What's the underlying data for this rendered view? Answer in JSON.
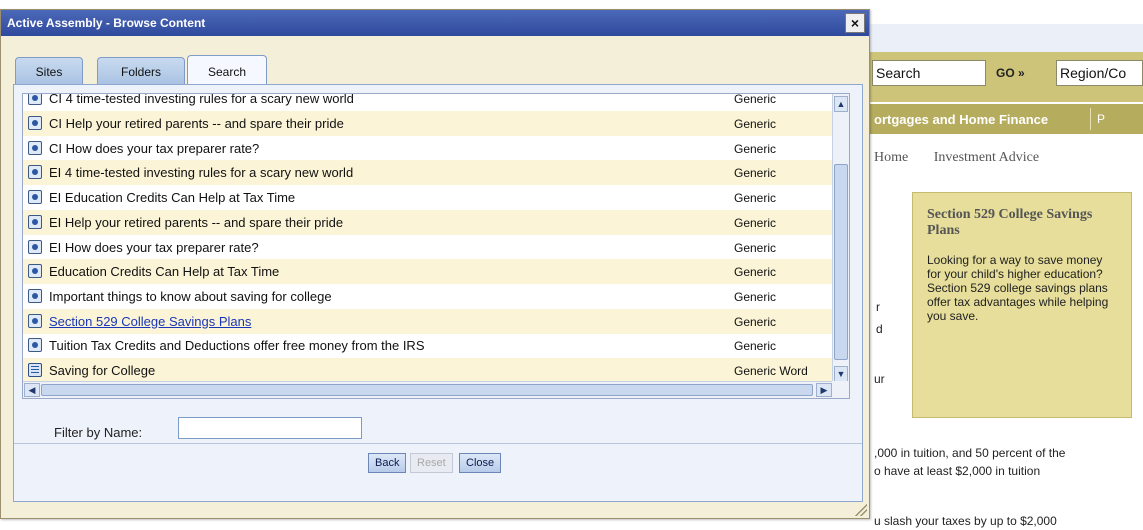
{
  "background_page": {
    "search_value": "Search",
    "go_label": "GO »",
    "region_value": "Region/Co",
    "nav_item": "ortgages and Home Finance",
    "nav_item_next": "P",
    "crumbs": [
      "Home",
      "Investment Advice"
    ],
    "promo": {
      "title": "Section 529 College Savings Plans",
      "body": "Looking for a way to save money for your child's higher education? Section 529 college savings plans offer tax advantages while helping you save."
    },
    "fragments": [
      "r",
      "d",
      "ur"
    ],
    "text_lines": [
      ",000 in tuition, and 50 percent of the",
      "o have at least $2,000 in tuition",
      "u slash your taxes by up to $2,000"
    ]
  },
  "dialog": {
    "title": "Active Assembly - Browse Content",
    "close_symbol": "×",
    "tabs": [
      {
        "label": "Sites",
        "active": false
      },
      {
        "label": "Folders",
        "active": false
      },
      {
        "label": "Search",
        "active": true
      }
    ],
    "partial_row": {
      "name": "CI 4 time-tested investing rules for a scary new world",
      "type": "Generic"
    },
    "rows": [
      {
        "name": "CI Help your retired parents -- and spare their pride",
        "type": "Generic",
        "icon": "web-document-icon",
        "link": false
      },
      {
        "name": "CI How does your tax preparer rate?",
        "type": "Generic",
        "icon": "web-document-icon",
        "link": false
      },
      {
        "name": "EI 4 time-tested investing rules for a scary new world",
        "type": "Generic",
        "icon": "web-document-icon",
        "link": false
      },
      {
        "name": "EI Education Credits Can Help at Tax Time",
        "type": "Generic",
        "icon": "web-document-icon",
        "link": false
      },
      {
        "name": "EI Help your retired parents -- and spare their pride",
        "type": "Generic",
        "icon": "web-document-icon",
        "link": false
      },
      {
        "name": "EI How does your tax preparer rate?",
        "type": "Generic",
        "icon": "web-document-icon",
        "link": false
      },
      {
        "name": "Education Credits Can Help at Tax Time",
        "type": "Generic",
        "icon": "web-document-icon",
        "link": false
      },
      {
        "name": "Important things to know about saving for college",
        "type": "Generic",
        "icon": "web-document-icon",
        "link": false
      },
      {
        "name": "Section 529 College Savings Plans",
        "type": "Generic",
        "icon": "web-document-icon",
        "link": true
      },
      {
        "name": "Tuition Tax Credits and Deductions offer free money from the IRS",
        "type": "Generic",
        "icon": "web-document-icon",
        "link": false
      },
      {
        "name": "Saving for College",
        "type": "Generic Word",
        "icon": "word-document-icon",
        "link": false
      }
    ],
    "filter_label": "Filter by Name:",
    "filter_value": "",
    "buttons": {
      "back": "Back",
      "reset": "Reset",
      "close": "Close"
    },
    "reset_disabled": true
  }
}
